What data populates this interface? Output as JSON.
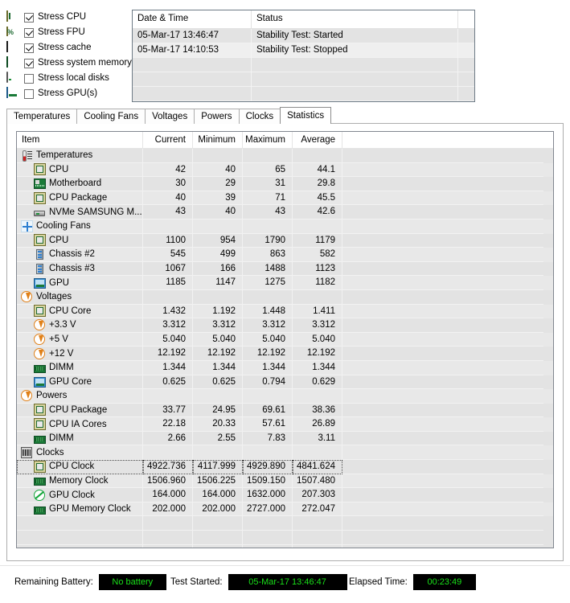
{
  "stress_options": [
    {
      "icon": "cpu-chip-icon",
      "label": "Stress CPU",
      "checked": true
    },
    {
      "icon": "fpu-icon",
      "label": "Stress FPU",
      "checked": true
    },
    {
      "icon": "cache-icon",
      "label": "Stress cache",
      "checked": true
    },
    {
      "icon": "memory-dimm-icon",
      "label": "Stress system memory",
      "checked": true
    },
    {
      "icon": "hard-disk-icon",
      "label": "Stress local disks",
      "checked": false
    },
    {
      "icon": "gpu-icon",
      "label": "Stress GPU(s)",
      "checked": false
    }
  ],
  "log": {
    "columns": [
      "Date & Time",
      "Status"
    ],
    "rows": [
      {
        "datetime": "05-Mar-17 13:46:47",
        "status": "Stability Test: Started"
      },
      {
        "datetime": "05-Mar-17 14:10:53",
        "status": "Stability Test: Stopped"
      }
    ],
    "empty_row_count": 3
  },
  "tabs": [
    {
      "label": "Temperatures",
      "active": false
    },
    {
      "label": "Cooling Fans",
      "active": false
    },
    {
      "label": "Voltages",
      "active": false
    },
    {
      "label": "Powers",
      "active": false
    },
    {
      "label": "Clocks",
      "active": false
    },
    {
      "label": "Statistics",
      "active": true
    }
  ],
  "statistics": {
    "columns": [
      "Item",
      "Current",
      "Minimum",
      "Maximum",
      "Average"
    ],
    "groups": [
      {
        "name": "Temperatures",
        "icon": "thermometer-icon",
        "rows": [
          {
            "icon": "cpu-chip-icon",
            "label": "CPU",
            "current": "42",
            "minimum": "40",
            "maximum": "65",
            "average": "44.1"
          },
          {
            "icon": "motherboard-icon",
            "label": "Motherboard",
            "current": "30",
            "minimum": "29",
            "maximum": "31",
            "average": "29.8"
          },
          {
            "icon": "cpu-chip-icon",
            "label": "CPU Package",
            "current": "40",
            "minimum": "39",
            "maximum": "71",
            "average": "45.5"
          },
          {
            "icon": "nvme-disk-icon",
            "label": "NVMe SAMSUNG M...",
            "current": "43",
            "minimum": "40",
            "maximum": "43",
            "average": "42.6"
          }
        ]
      },
      {
        "name": "Cooling Fans",
        "icon": "fan-icon",
        "rows": [
          {
            "icon": "cpu-chip-icon",
            "label": "CPU",
            "current": "1100",
            "minimum": "954",
            "maximum": "1790",
            "average": "1179"
          },
          {
            "icon": "chassis-icon",
            "label": "Chassis #2",
            "current": "545",
            "minimum": "499",
            "maximum": "863",
            "average": "582"
          },
          {
            "icon": "chassis-icon",
            "label": "Chassis #3",
            "current": "1067",
            "minimum": "166",
            "maximum": "1488",
            "average": "1123"
          },
          {
            "icon": "gpu-icon",
            "label": "GPU",
            "current": "1185",
            "minimum": "1147",
            "maximum": "1275",
            "average": "1182"
          }
        ]
      },
      {
        "name": "Voltages",
        "icon": "voltage-icon",
        "rows": [
          {
            "icon": "cpu-chip-icon",
            "label": "CPU Core",
            "current": "1.432",
            "minimum": "1.192",
            "maximum": "1.448",
            "average": "1.411"
          },
          {
            "icon": "voltage-icon",
            "label": "+3.3 V",
            "current": "3.312",
            "minimum": "3.312",
            "maximum": "3.312",
            "average": "3.312"
          },
          {
            "icon": "voltage-icon",
            "label": "+5 V",
            "current": "5.040",
            "minimum": "5.040",
            "maximum": "5.040",
            "average": "5.040"
          },
          {
            "icon": "voltage-icon",
            "label": "+12 V",
            "current": "12.192",
            "minimum": "12.192",
            "maximum": "12.192",
            "average": "12.192"
          },
          {
            "icon": "memory-dimm-icon",
            "label": "DIMM",
            "current": "1.344",
            "minimum": "1.344",
            "maximum": "1.344",
            "average": "1.344"
          },
          {
            "icon": "gpu-icon",
            "label": "GPU Core",
            "current": "0.625",
            "minimum": "0.625",
            "maximum": "0.794",
            "average": "0.629"
          }
        ]
      },
      {
        "name": "Powers",
        "icon": "voltage-icon",
        "rows": [
          {
            "icon": "cpu-chip-icon",
            "label": "CPU Package",
            "current": "33.77",
            "minimum": "24.95",
            "maximum": "69.61",
            "average": "38.36"
          },
          {
            "icon": "cpu-chip-icon",
            "label": "CPU IA Cores",
            "current": "22.18",
            "minimum": "20.33",
            "maximum": "57.61",
            "average": "26.89"
          },
          {
            "icon": "memory-dimm-icon",
            "label": "DIMM",
            "current": "2.66",
            "minimum": "2.55",
            "maximum": "7.83",
            "average": "3.11"
          }
        ]
      },
      {
        "name": "Clocks",
        "icon": "clocks-icon",
        "rows": [
          {
            "icon": "cpu-chip-icon",
            "label": "CPU Clock",
            "current": "4922.736",
            "minimum": "4117.999",
            "maximum": "4929.890",
            "average": "4841.624",
            "focused": true
          },
          {
            "icon": "memory-dimm-icon",
            "label": "Memory Clock",
            "current": "1506.960",
            "minimum": "1506.225",
            "maximum": "1509.150",
            "average": "1507.480"
          },
          {
            "icon": "gpu-clock-icon",
            "label": "GPU Clock",
            "current": "164.000",
            "minimum": "164.000",
            "maximum": "1632.000",
            "average": "207.303"
          },
          {
            "icon": "memory-dimm-icon",
            "label": "GPU Memory Clock",
            "current": "202.000",
            "minimum": "202.000",
            "maximum": "2727.000",
            "average": "272.047"
          }
        ]
      }
    ],
    "filler_row_count": 4
  },
  "statusbar": {
    "battery_label": "Remaining Battery:",
    "battery_value": "No battery",
    "started_label": "Test Started:",
    "started_value": "05-Mar-17 13:46:47",
    "elapsed_label": "Elapsed Time:",
    "elapsed_value": "00:23:49",
    "value_color": "#19e019",
    "value_background": "#000000"
  }
}
